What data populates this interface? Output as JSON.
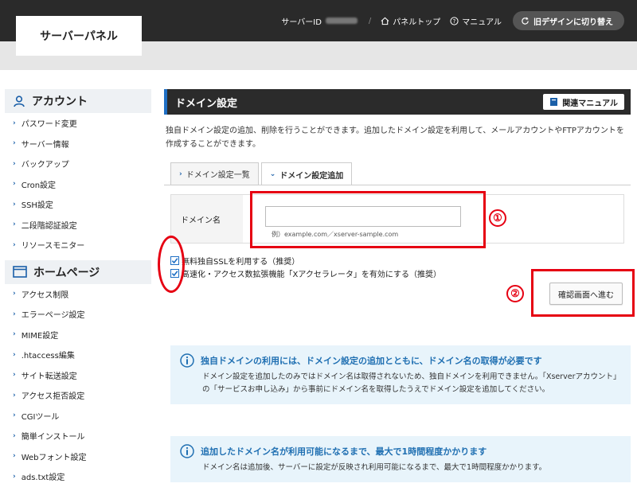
{
  "header": {
    "logo": "サーバーパネル",
    "server_id_label": "サーバーID",
    "separator": "/",
    "panel_top": "パネルトップ",
    "manual": "マニュアル",
    "old_design": "旧デザインに切り替え"
  },
  "sidebar": {
    "account_heading": "アカウント",
    "account_items": [
      "パスワード変更",
      "サーバー情報",
      "バックアップ",
      "Cron設定",
      "SSH設定",
      "二段階認証設定",
      "リソースモニター"
    ],
    "homepage_heading": "ホームページ",
    "homepage_items": [
      "アクセス制限",
      "エラーページ設定",
      "MIME設定",
      ".htaccess編集",
      "サイト転送設定",
      "アクセス拒否設定",
      "CGIツール",
      "簡単インストール",
      "Webフォント設定",
      "ads.txt設定"
    ]
  },
  "main": {
    "title": "ドメイン設定",
    "manual_button": "関連マニュアル",
    "description": "独自ドメイン設定の追加、削除を行うことができます。追加したドメイン設定を利用して、メールアカウントやFTPアカウントを作成することができます。",
    "tabs": [
      {
        "label": "ドメイン設定一覧",
        "active": false
      },
      {
        "label": "ドメイン設定追加",
        "active": true
      }
    ],
    "domain_label": "ドメイン名",
    "domain_value": "",
    "domain_hint": "例）example.com／xserver-sample.com",
    "checkboxes": [
      {
        "label": "無料独自SSLを利用する（推奨）",
        "checked": true
      },
      {
        "label": "高速化・アクセス数拡張機能「Xアクセラレータ」を有効にする（推奨）",
        "checked": true
      }
    ],
    "confirm_button": "確認画面へ進む",
    "info1": {
      "title": "独自ドメインの利用には、ドメイン設定の追加とともに、ドメイン名の取得が必要です",
      "body": "ドメイン設定を追加したのみではドメイン名は取得されないため、独自ドメインを利用できません。「Xserverアカウント」の「サービスお申し込み」から事前にドメイン名を取得したうえでドメイン設定を追加してください。"
    },
    "info2": {
      "title": "追加したドメイン名が利用可能になるまで、最大で1時間程度かかります",
      "body": "ドメイン名は追加後、サーバーに設定が反映され利用可能になるまで、最大で1時間程度かかります。"
    }
  },
  "annotations": {
    "num1": "①",
    "num2": "②"
  },
  "colors": {
    "annotation_red": "#e60012",
    "accent_blue": "#1f6fc4",
    "info_bg": "#e8f4fb"
  }
}
